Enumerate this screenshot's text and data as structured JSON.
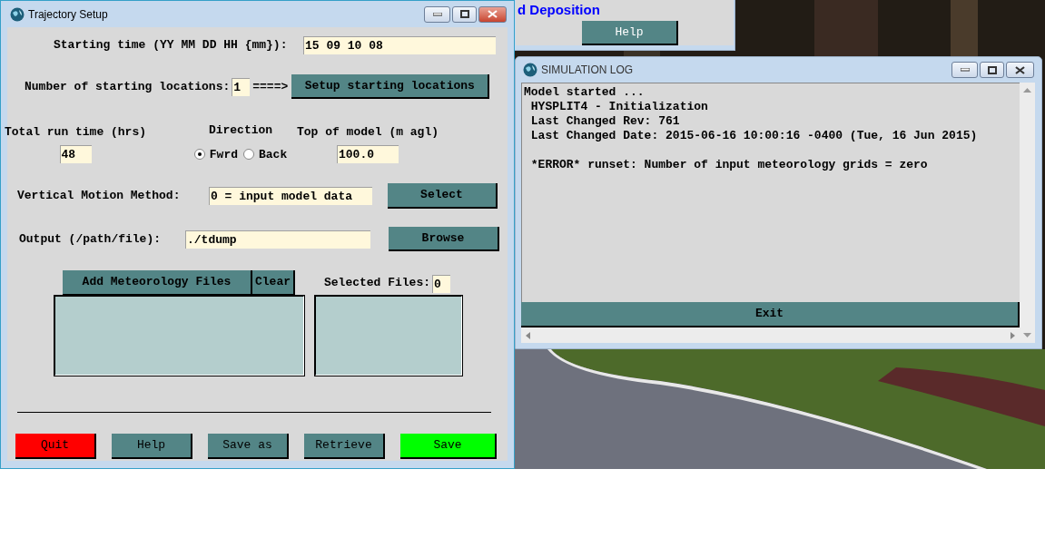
{
  "background_window": {
    "heading": "d Deposition",
    "button": "Help"
  },
  "trajectory_setup": {
    "title": "Trajectory Setup",
    "starting_time": {
      "label": "Starting time (YY MM DD HH {mm}):",
      "value": "15 09 10 08"
    },
    "starting_locations": {
      "label": "Number of starting locations:",
      "value": "1",
      "arrow": "====>",
      "button": "Setup starting locations"
    },
    "run_time": {
      "label": "Total run time (hrs)",
      "value": "48"
    },
    "direction": {
      "label": "Direction",
      "options": [
        {
          "label": "Fwrd",
          "selected": true
        },
        {
          "label": "Back",
          "selected": false
        }
      ]
    },
    "top_of_model": {
      "label": "Top of model (m agl)",
      "value": "100.0"
    },
    "vertical_motion": {
      "label": "Vertical Motion Method:",
      "value": "0 = input model data",
      "button": "Select"
    },
    "output": {
      "label": "Output (/path/file):",
      "value": "./tdump",
      "button": "Browse"
    },
    "meteorology": {
      "add_button": "Add Meteorology Files",
      "clear_button": "Clear",
      "selected_label": "Selected Files:",
      "selected_count": "0"
    },
    "buttons": [
      {
        "label": "Quit",
        "color": "#ff0000"
      },
      {
        "label": "Help",
        "color": "#538586"
      },
      {
        "label": "Save as",
        "color": "#538586"
      },
      {
        "label": "Retrieve",
        "color": "#538586"
      },
      {
        "label": "Save",
        "color": "#00ff00"
      }
    ]
  },
  "simulation_log": {
    "title": "SIMULATION LOG",
    "lines": [
      "Model started ...",
      " HYSPLIT4 - Initialization",
      " Last Changed Rev: 761",
      " Last Changed Date: 2015-06-16 10:00:16 -0400 (Tue, 16 Jun 2015)"
    ],
    "error": " *ERROR* runset: Number of input meteorology grids = zero",
    "button": "Exit"
  }
}
